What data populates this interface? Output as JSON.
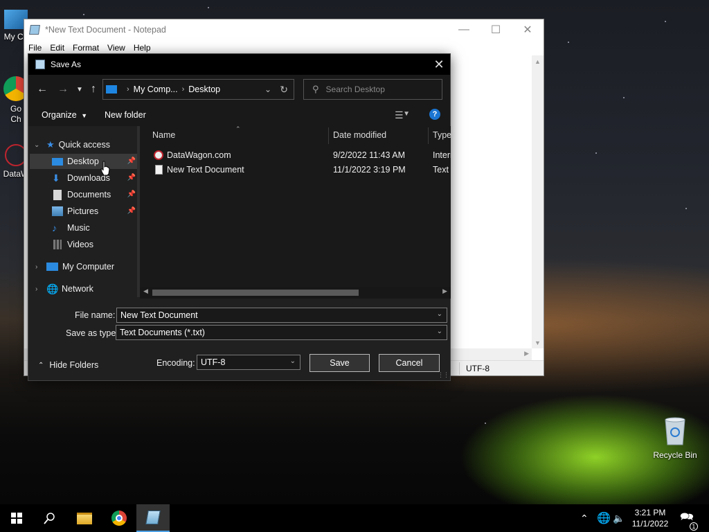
{
  "desktop": {
    "icons": [
      {
        "label": "My Co",
        "name": "my-computer"
      },
      {
        "label": "Go Ch",
        "name": "google-chrome"
      },
      {
        "label": "DataW",
        "name": "datawagon"
      }
    ],
    "recycle_bin": "Recycle Bin"
  },
  "notepad": {
    "title": "*New Text Document - Notepad",
    "menu": [
      "File",
      "Edit",
      "Format",
      "View",
      "Help"
    ],
    "status_encoding": "UTF-8"
  },
  "dialog": {
    "title": "Save As",
    "breadcrumb": [
      "My Comp...",
      "Desktop"
    ],
    "search_placeholder": "Search Desktop",
    "toolbar": {
      "organize": "Organize",
      "new_folder": "New folder",
      "help": "?"
    },
    "nav": {
      "quick_access": "Quick access",
      "items": [
        "Desktop",
        "Downloads",
        "Documents",
        "Pictures",
        "Music",
        "Videos"
      ],
      "my_computer": "My Computer",
      "network": "Network"
    },
    "columns": {
      "name": "Name",
      "date_modified": "Date modified",
      "type": "Type"
    },
    "files": [
      {
        "name": "DataWagon.com",
        "date": "9/2/2022 11:43 AM",
        "type": "Intern"
      },
      {
        "name": "New Text Document",
        "date": "11/1/2022 3:19 PM",
        "type": "Text D"
      }
    ],
    "file_name_label": "File name:",
    "file_name_value": "New Text Document",
    "save_as_type_label": "Save as type:",
    "save_as_type_value": "Text Documents (*.txt)",
    "encoding_label": "Encoding:",
    "encoding_value": "UTF-8",
    "save_button": "Save",
    "cancel_button": "Cancel",
    "hide_folders": "Hide Folders"
  },
  "taskbar": {
    "time": "3:21 PM",
    "date": "11/1/2022",
    "notification_count": "1"
  },
  "colors": {
    "accent": "#1a75d2",
    "dialog_bg": "#202020",
    "titlebar": "#000000"
  }
}
